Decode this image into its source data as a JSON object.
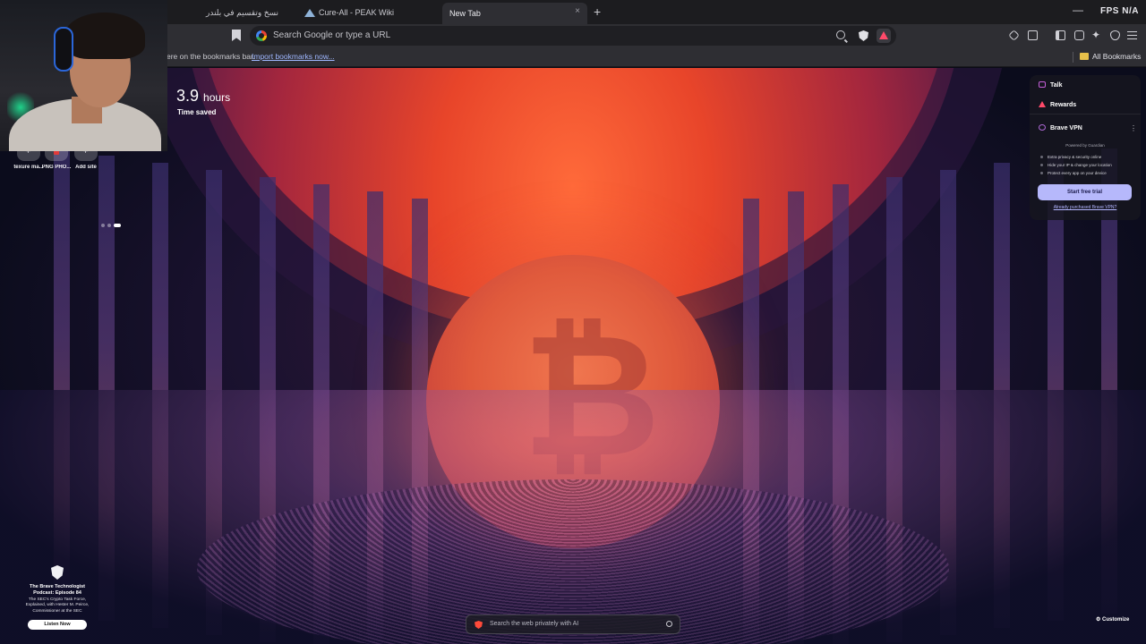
{
  "tabs": [
    {
      "title": "نسخ وتقسيم في بلندر",
      "close": "×"
    },
    {
      "title": "Cure-All - PEAK Wiki",
      "close": "×"
    },
    {
      "title": "New Tab",
      "close": "×",
      "active": true
    }
  ],
  "new_tab_label": "+",
  "window": {
    "minimize": "—",
    "recording_badge": "FPS N/A"
  },
  "omnibox": {
    "placeholder": "Search Google or type a URL"
  },
  "bookmarks_bar": {
    "message": "ere on the bookmarks bar.",
    "import_link": "Import bookmarks now...",
    "all_bookmarks": "All Bookmarks"
  },
  "stats": {
    "value": "3.9",
    "unit": "hours",
    "label": "Time saved"
  },
  "top_sites": [
    {
      "label": "texure ma..."
    },
    {
      "label": "PNG PHO..."
    },
    {
      "label": "Add site"
    }
  ],
  "widgets": {
    "talk": "Talk",
    "rewards": "Rewards",
    "vpn": {
      "title": "Brave VPN",
      "menu": "⋮",
      "powered_by": "Powered by Guardian",
      "features": [
        "Extra privacy & security online",
        "Hide your IP & change your location",
        "Protect every app on your device"
      ],
      "cta": "Start free trial",
      "link": "Already purchased Brave VPN?"
    }
  },
  "podcast": {
    "title": "The Brave Technologist Podcast: Episode 84",
    "description": "The SEC's Crypto Task Force, Explained, with Hester M. Peirce, Commissioner at the SEC",
    "cta": "Listen Now"
  },
  "ai_search": {
    "placeholder": "Search the web privately with AI"
  },
  "customize": "Customize",
  "background": {
    "mark": "₿"
  },
  "colors": {
    "accent_vpn_button": "#b6b8fb",
    "brave_red": "#ff4a3a"
  }
}
